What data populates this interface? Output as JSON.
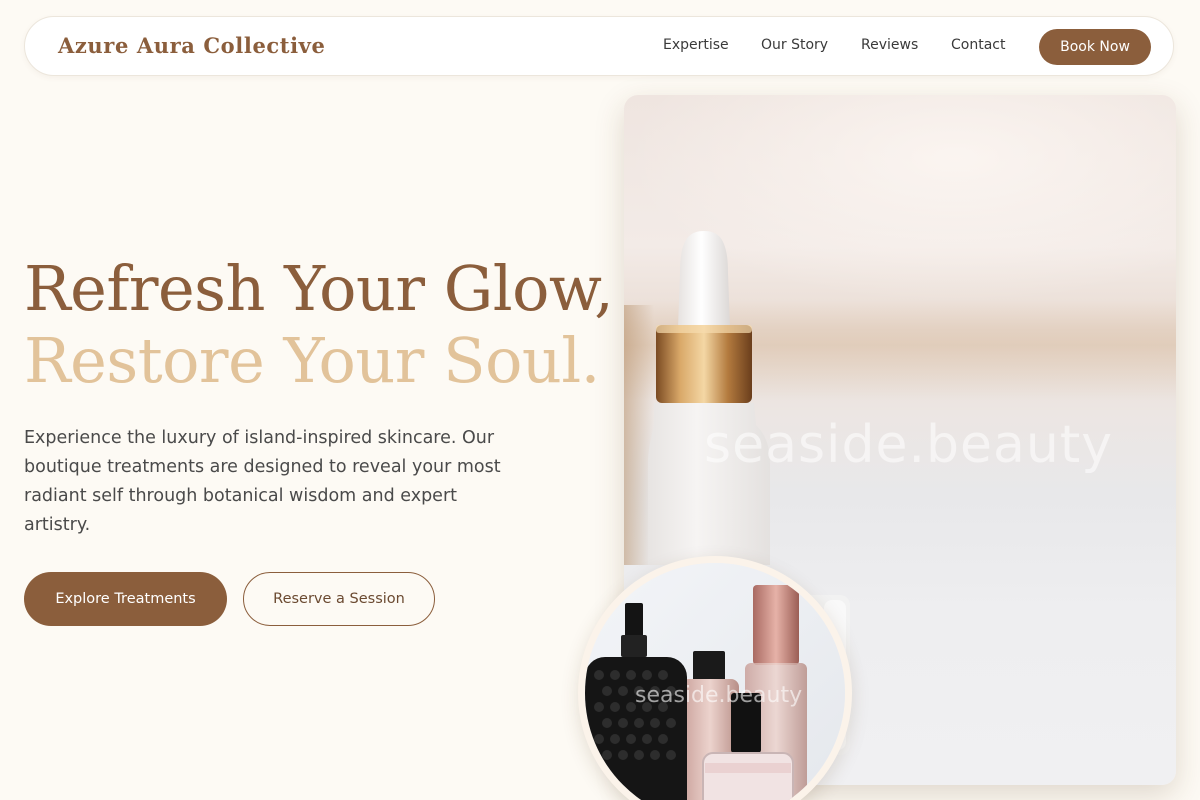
{
  "brand": {
    "name": "Azure Aura Collective"
  },
  "nav": {
    "items": [
      {
        "label": "Expertise"
      },
      {
        "label": "Our Story"
      },
      {
        "label": "Reviews"
      },
      {
        "label": "Contact"
      }
    ],
    "cta_label": "Book Now"
  },
  "hero": {
    "headline_line1": "Refresh Your Glow,",
    "headline_line2": "Restore Your Soul.",
    "description": "Experience the luxury of island-inspired skincare. Our boutique treatments are designed to reveal your most radiant self through botanical wisdom and expert artistry.",
    "primary_button": "Explore Treatments",
    "secondary_button": "Reserve a Session",
    "image_watermark": "seaside.beauty",
    "inset_watermark": "seaside.beauty"
  },
  "colors": {
    "brand_brown": "#8b5e3c",
    "accent_gold": "#e2c39a",
    "background": "#fdfaf4"
  },
  "icons": [
    "serum-bottle-image",
    "perfume-bottles-image"
  ]
}
